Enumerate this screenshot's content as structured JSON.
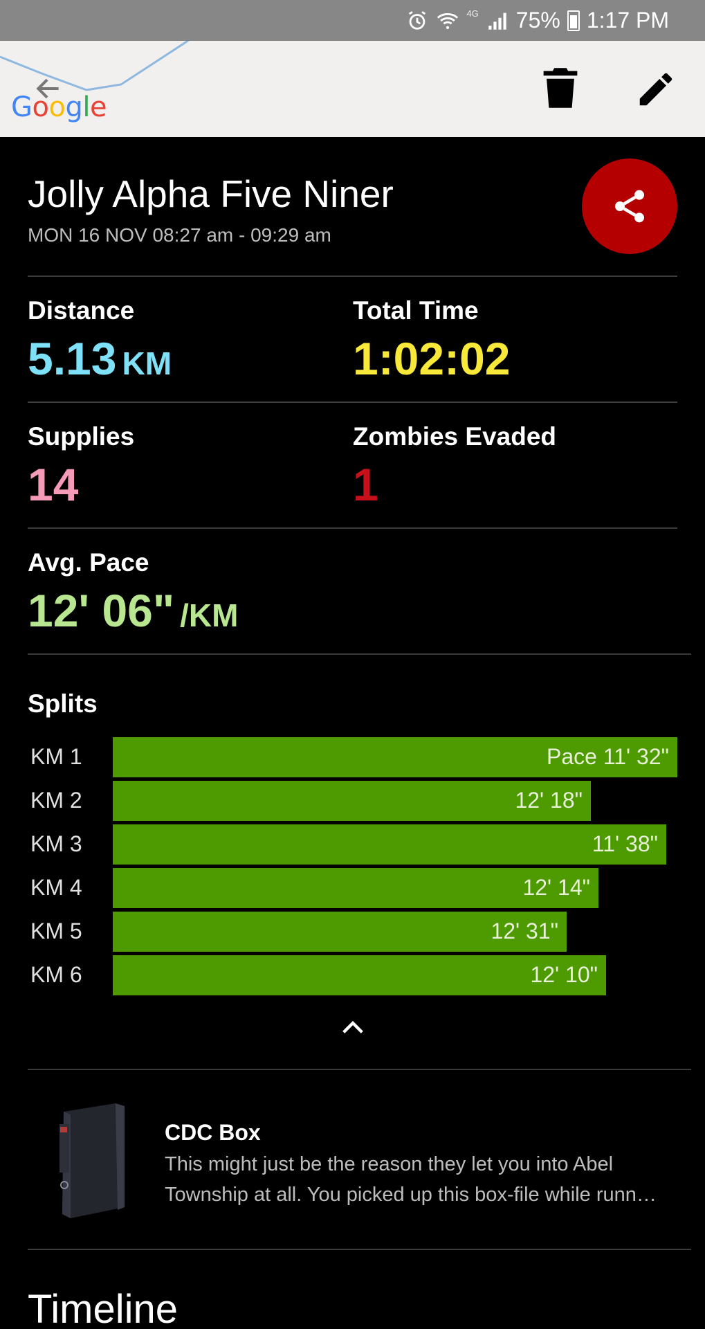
{
  "status_bar": {
    "battery": "75%",
    "time": "1:17 PM",
    "network": "4G"
  },
  "map": {
    "brand": "Google"
  },
  "run": {
    "title": "Jolly Alpha Five Niner",
    "date": "MON 16 NOV 08:27 am - 09:29 am"
  },
  "stats": {
    "distance": {
      "label": "Distance",
      "value": "5.13",
      "unit": "KM",
      "color": "#7fe1f7"
    },
    "total_time": {
      "label": "Total Time",
      "value": "1:02:02",
      "color": "#f7e83a"
    },
    "supplies": {
      "label": "Supplies",
      "value": "14",
      "color": "#f59bb7"
    },
    "zombies": {
      "label": "Zombies Evaded",
      "value": "1",
      "color": "#c8101b"
    },
    "pace": {
      "label": "Avg. Pace",
      "value": "12' 06\"",
      "unit": "/KM",
      "color": "#b9e690"
    }
  },
  "splits": {
    "title": "Splits",
    "bar_color": "#4d9b00",
    "rows": [
      {
        "label": "KM 1",
        "text": "Pace 11' 32\"",
        "pace_seconds": 692
      },
      {
        "label": "KM 2",
        "text": "12' 18\"",
        "pace_seconds": 738
      },
      {
        "label": "KM 3",
        "text": "11' 38\"",
        "pace_seconds": 698
      },
      {
        "label": "KM 4",
        "text": "12' 14\"",
        "pace_seconds": 734
      },
      {
        "label": "KM 5",
        "text": "12' 31\"",
        "pace_seconds": 751
      },
      {
        "label": "KM 6",
        "text": "12' 10\"",
        "pace_seconds": 730
      }
    ]
  },
  "item": {
    "title": "CDC Box",
    "desc_line1": "This might just be the reason they let you into Abel",
    "desc_line2": "Township at all. You picked up this box-file while runn…"
  },
  "timeline": {
    "title": "Timeline"
  },
  "colors": {
    "share": "#b40000",
    "divider": "#3b3b3b"
  }
}
